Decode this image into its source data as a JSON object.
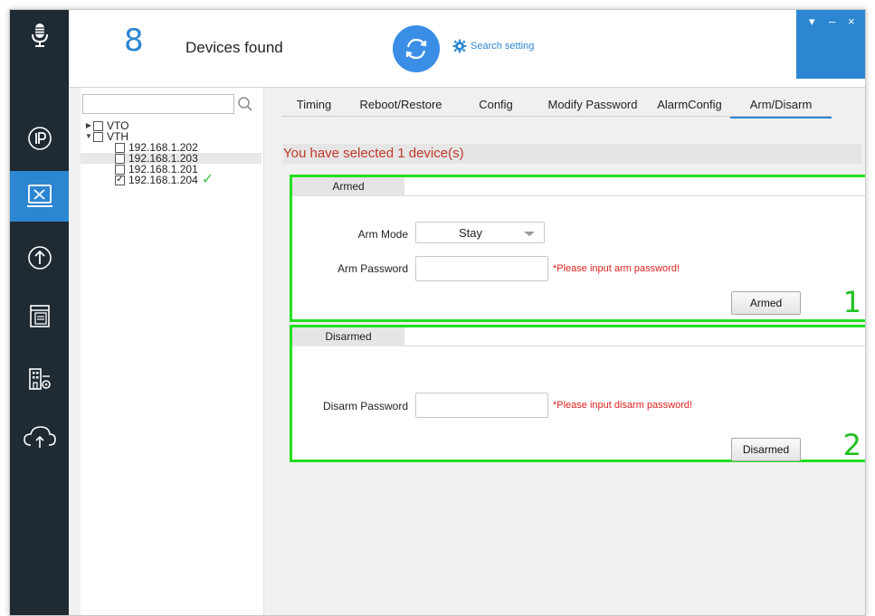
{
  "header": {
    "device_count": "8",
    "devices_found_label": "Devices found",
    "search_setting_label": "Search setting"
  },
  "window_controls": {
    "menu": "▾",
    "minimize": "–",
    "close": "×"
  },
  "sidebar": {
    "items": [
      {
        "icon": "microphone-icon"
      },
      {
        "icon": "ip-icon"
      },
      {
        "icon": "tools-icon",
        "active": true
      },
      {
        "icon": "upgrade-icon"
      },
      {
        "icon": "document-icon"
      },
      {
        "icon": "building-settings-icon"
      },
      {
        "icon": "cloud-upload-icon"
      }
    ]
  },
  "tree": {
    "search_placeholder": "",
    "nodes": [
      {
        "label": "VTO",
        "expanded": false,
        "checked": false
      },
      {
        "label": "VTH",
        "expanded": true,
        "checked": false
      },
      {
        "label": "192.168.1.202",
        "checked": false
      },
      {
        "label": "192.168.1.203",
        "checked": false,
        "highlighted": true
      },
      {
        "label": "192.168.1.201",
        "checked": false
      },
      {
        "label": "192.168.1.204",
        "checked": true,
        "status": "ok"
      }
    ]
  },
  "tabs": [
    {
      "label": "Timing"
    },
    {
      "label": "Reboot/Restore"
    },
    {
      "label": "Config"
    },
    {
      "label": "Modify Password"
    },
    {
      "label": "AlarmConfig"
    },
    {
      "label": "Arm/Disarm",
      "active": true
    }
  ],
  "selection_status": "You have selected 1 device(s)",
  "armed_group": {
    "title": "Armed",
    "number": "1",
    "arm_mode_label": "Arm Mode",
    "arm_mode_value": "Stay",
    "arm_password_label": "Arm Password",
    "arm_password_value": "",
    "arm_password_hint": "*Please input arm password!",
    "button_label": "Armed"
  },
  "disarmed_group": {
    "title": "Disarmed",
    "number": "2",
    "disarm_password_label": "Disarm Password",
    "disarm_password_value": "",
    "disarm_password_hint": "*Please input disarm password!",
    "button_label": "Disarmed"
  },
  "colors": {
    "accent": "#2d86d1",
    "sidebar_bg": "#1f2a33",
    "highlight_border": "#22e022",
    "error_text": "#e02020",
    "status_text": "#c0392b"
  }
}
